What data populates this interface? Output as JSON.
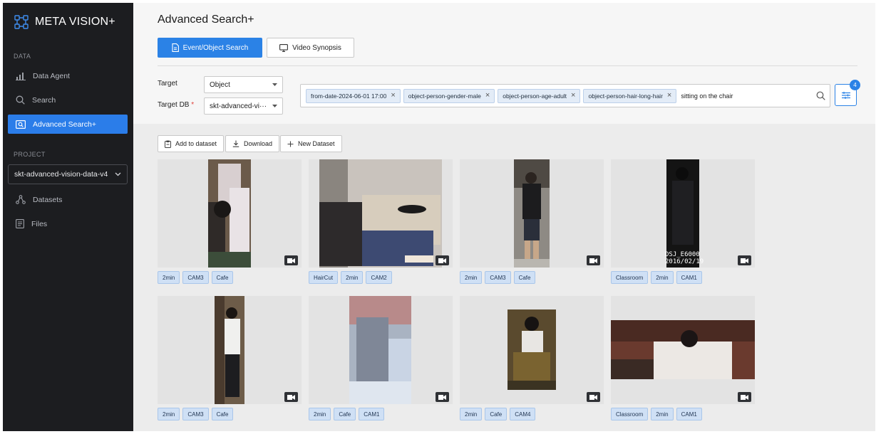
{
  "app": {
    "name": "META VISION+"
  },
  "sidebar": {
    "section_data": "DATA",
    "section_project": "PROJECT",
    "items": [
      {
        "label": "Data Agent",
        "icon": "bar-chart-icon"
      },
      {
        "label": "Search",
        "icon": "search-icon"
      },
      {
        "label": "Advanced Search+",
        "icon": "image-search-icon",
        "active": true
      }
    ],
    "project_select": "skt-advanced-vision-data-v4",
    "project_items": [
      {
        "label": "Datasets",
        "icon": "nodes-icon"
      },
      {
        "label": "Files",
        "icon": "file-icon"
      }
    ]
  },
  "page": {
    "title": "Advanced Search+",
    "tabs": [
      {
        "label": "Event/Object Search",
        "icon": "document-icon",
        "active": true
      },
      {
        "label": "Video Synopsis",
        "icon": "monitor-icon"
      }
    ],
    "target_label": "Target",
    "target_value": "Object",
    "target_db_label": "Target DB",
    "target_db_required": "*",
    "target_db_value": "skt-advanced-vi···",
    "search_chips": [
      "from-date-2024-06-01 17:00",
      "object-person-gender-male",
      "object-person-age-adult",
      "object-person-hair-long-hair"
    ],
    "search_text": "sitting on the chair",
    "filter_count": "4",
    "actions": {
      "add_to_dataset": "Add to dataset",
      "download": "Download",
      "new_dataset": "New Dataset"
    }
  },
  "results": [
    {
      "tags": [
        "2min",
        "CAM3",
        "Cafe"
      ]
    },
    {
      "tags": [
        "HairCut",
        "2min",
        "CAM2"
      ]
    },
    {
      "tags": [
        "2min",
        "CAM3",
        "Cafe"
      ]
    },
    {
      "tags": [
        "Classroom",
        "2min",
        "CAM1"
      ],
      "overlay": [
        "DSJ_E6000",
        "2016/02/19"
      ]
    },
    {
      "tags": [
        "2min",
        "CAM3",
        "Cafe"
      ]
    },
    {
      "tags": [
        "2min",
        "Cafe",
        "CAM1"
      ]
    },
    {
      "tags": [
        "2min",
        "Cafe",
        "CAM4"
      ]
    },
    {
      "tags": [
        "Classroom",
        "2min",
        "CAM1"
      ]
    }
  ],
  "colors": {
    "accent": "#2b82e6",
    "sidebar": "#1c1d20",
    "tag_bg": "#cfe0f5"
  }
}
